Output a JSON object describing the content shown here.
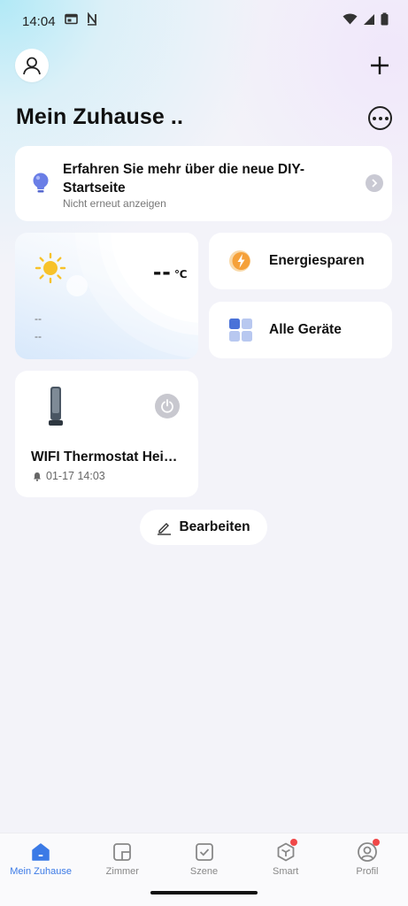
{
  "status_bar": {
    "time": "14:04",
    "icons": [
      "calendar-icon",
      "n-notification-icon",
      "wifi-icon",
      "signal-icon",
      "battery-icon"
    ]
  },
  "header": {
    "title": "Mein Zuhause ..",
    "icons": [
      "avatar-icon",
      "plus-icon",
      "more-icon"
    ]
  },
  "promo": {
    "title": "Erfahren Sie mehr über die neue DIY-Startseite",
    "subtitle": "Nicht erneut anzeigen",
    "icon": "lightbulb-icon"
  },
  "weather": {
    "temperature": "--",
    "unit": "℃",
    "line1": "--",
    "line2": "--",
    "icon": "sun-icon"
  },
  "actions": [
    {
      "label": "Energiesparen",
      "icon": "energy-icon"
    },
    {
      "label": "Alle Geräte",
      "icon": "grid-icon"
    }
  ],
  "device": {
    "name": "WIFI Thermostat Hei…",
    "time": "01-17 14:03",
    "icon": "heater-icon"
  },
  "edit": {
    "label": "Bearbeiten"
  },
  "bottom_nav": {
    "items": [
      {
        "label": "Mein Zuhause",
        "icon": "home-icon",
        "active": true
      },
      {
        "label": "Zimmer",
        "icon": "room-icon"
      },
      {
        "label": "Szene",
        "icon": "scene-icon"
      },
      {
        "label": "Smart",
        "icon": "smart-icon",
        "badge": true
      },
      {
        "label": "Profil",
        "icon": "profile-icon",
        "badge": true
      }
    ]
  },
  "colors": {
    "accent": "#3b7ae6",
    "background": "#f3f3f9",
    "badge": "#f04848",
    "energy": "#f5a13a"
  }
}
